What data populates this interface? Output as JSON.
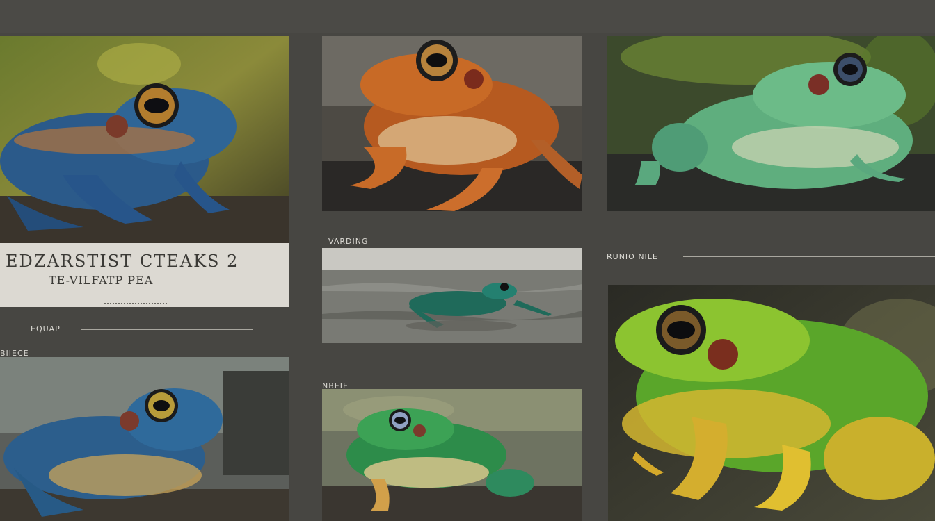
{
  "caption": {
    "line1": "EDZARSTIST CTEAKS 2",
    "line2": "TE-VILFATP PEA"
  },
  "labels": {
    "left_mid": "EQUAP",
    "left_section": "BIIECE",
    "center_top": "VARDING",
    "center_mid": "NBEIE",
    "right_mid": "RUNIO NILE"
  },
  "photos": [
    {
      "name": "blue-frog-photo",
      "subject": "blue frog on branch"
    },
    {
      "name": "orange-frog-photo",
      "subject": "orange frog on rock"
    },
    {
      "name": "green-frog-photo",
      "subject": "pale green frog on rock"
    },
    {
      "name": "swimming-frog-photo",
      "subject": "green frog in water"
    },
    {
      "name": "pond-frog-photo",
      "subject": "green frog near pond"
    },
    {
      "name": "blue-frog-photo-2",
      "subject": "blue frog close-up"
    },
    {
      "name": "yellow-green-frog-photo",
      "subject": "yellow green frog"
    }
  ],
  "colors": {
    "background": "#474642",
    "caption_bg": "#dcd9d2",
    "label_text": "#dcdad4"
  }
}
